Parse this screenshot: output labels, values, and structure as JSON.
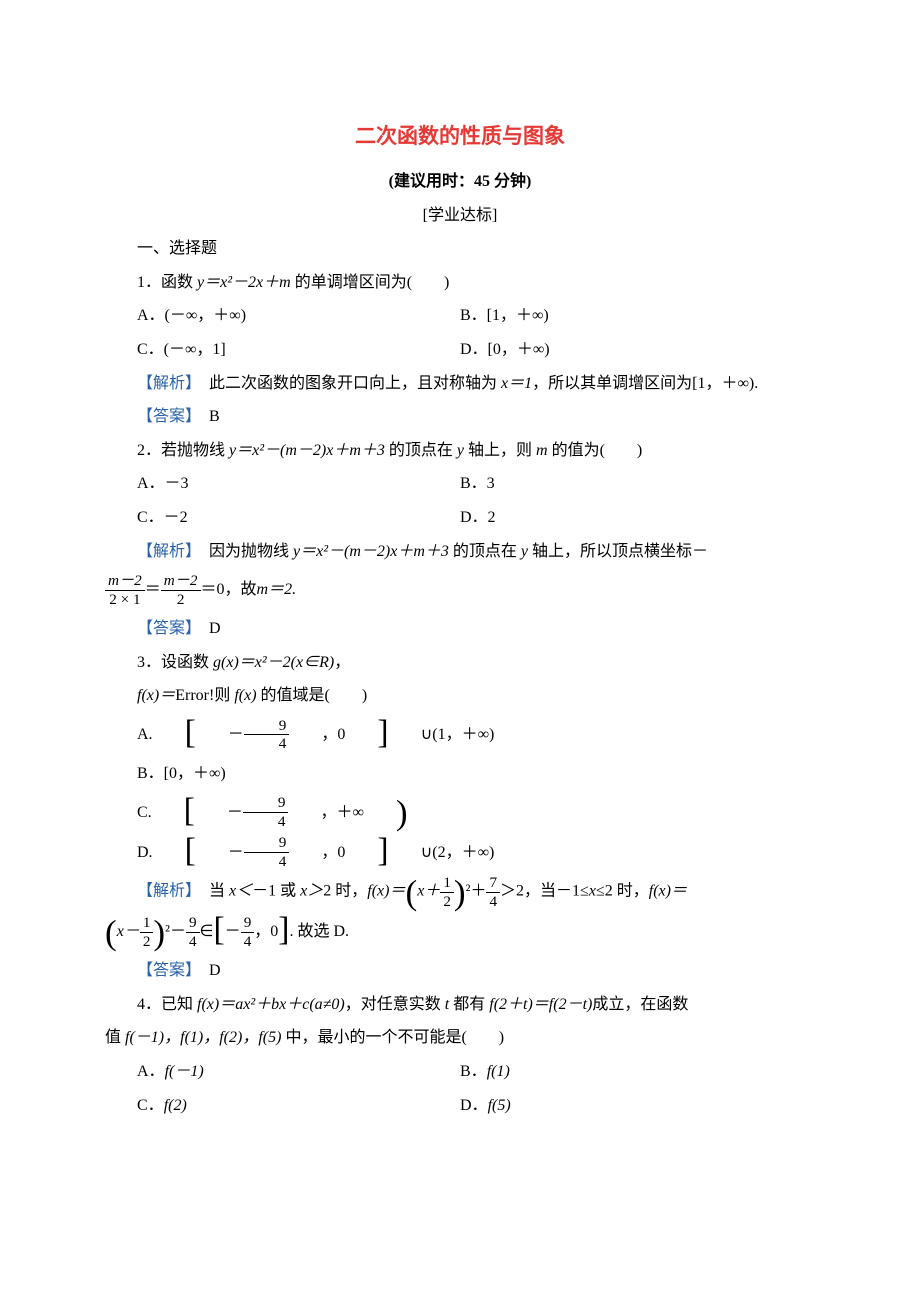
{
  "title": "二次函数的性质与图象",
  "recommended_time": "(建议用时：45 分钟)",
  "section_marker": "[学业达标]",
  "section1_heading": "一、选择题",
  "q1": {
    "stem_pref": "1．函数 ",
    "stem_math": "y＝x²－2x＋m",
    "stem_suf": " 的单调增区间为(　　)",
    "optA": "A．(－∞，＋∞)",
    "optB": "B．[1，＋∞)",
    "optC": "C．(－∞，1]",
    "optD": "D．[0，＋∞)",
    "exp_label": "【解析】",
    "exp_pref": "　此二次函数的图象开口向上，且对称轴为 ",
    "exp_math": "x＝1",
    "exp_suf": "，所以其单调增区间为[1，＋∞).",
    "ans_label": "【答案】",
    "ans": "　B"
  },
  "q2": {
    "stem_pref": "2．若抛物线 ",
    "stem_math": "y＝x²－(m－2)x＋m＋3",
    "stem_suf1": " 的顶点在 ",
    "stem_math2": "y",
    "stem_suf2": " 轴上，则 ",
    "stem_math3": "m",
    "stem_suf3": " 的值为(　　)",
    "optA": "A．－3",
    "optB": "B．3",
    "optC": "C．－2",
    "optD": "D．2",
    "exp_label": "【解析】",
    "exp_pref": "　因为抛物线 ",
    "exp_math1": "y＝x²－(m－2)x＋m＋3",
    "exp_mid1": " 的顶点在 ",
    "exp_math2": "y",
    "exp_mid2": " 轴上，所以顶点横坐标－",
    "frac1_num": "m－2",
    "frac1_den": "2 × 1",
    "eq1": "＝",
    "frac2_num": "m－2",
    "frac2_den": "2",
    "eq2": "＝0，故 ",
    "exp_math3": "m＝2.",
    "ans_label": "【答案】",
    "ans": "　D"
  },
  "q3": {
    "line1_pref": "3．设函数 ",
    "line1_math": "g(x)＝x²－2(x∈R)",
    "line1_suf": "，",
    "line2_pref": "f(x)＝",
    "line2_err": "Error!",
    "line2_mid": "则 ",
    "line2_math": "f(x)",
    "line2_suf": " 的值域是(　　)",
    "optA_pref": "A.",
    "optA_frac_num": "9",
    "optA_frac_den": "4",
    "optA_mid": "，0",
    "optA_suf": "∪(1，＋∞)",
    "optB": "B．[0，＋∞)",
    "optC_pref": "C.",
    "optC_frac_num": "9",
    "optC_frac_den": "4",
    "optC_suf": "，＋∞",
    "optD_pref": "D.",
    "optD_frac_num": "9",
    "optD_frac_den": "4",
    "optD_mid": "，0",
    "optD_suf": "∪(2，＋∞)",
    "exp_label": "【解析】",
    "exp_pref": "　当 ",
    "exp_m1": "x＜",
    "exp_m2": "－1 或 ",
    "exp_m3": "x＞",
    "exp_m4": "2 时，",
    "exp_m5": "f(x)＝",
    "exp_frac1_num": "1",
    "exp_frac1_den": "2",
    "exp_m6": "²＋",
    "exp_frac2_num": "7",
    "exp_frac2_den": "4",
    "exp_m7": "＞2，当－1≤",
    "exp_m7b": "x",
    "exp_m7c": "≤2 时，",
    "exp_m8": "f(x)＝",
    "exp_frac3_num": "1",
    "exp_frac3_den": "2",
    "exp_m9": "²－",
    "exp_frac4_num": "9",
    "exp_frac4_den": "4",
    "exp_m10": "∈",
    "exp_frac5_num": "9",
    "exp_frac5_den": "4",
    "exp_m11": "，0",
    "exp_end": ". 故选 D.",
    "ans_label": "【答案】",
    "ans": "　D"
  },
  "q4": {
    "line1_pref": "4．已知 ",
    "line1_math1": "f(x)＝ax²＋bx＋c(a≠0)",
    "line1_mid1": "，对任意实数 ",
    "line1_math2": "t",
    "line1_mid2": " 都有 ",
    "line1_math3": "f(2＋t)＝f(2－t)",
    "line1_suf": "成立，在函数",
    "line2_pref": "值 ",
    "line2_math": "f(－1)，f(1)，f(2)，f(5)",
    "line2_suf": " 中，最小的一个不可能是(　　)",
    "optA_pref": "A．",
    "optA_math": "f(－1)",
    "optB_pref": "B．",
    "optB_math": "f(1)",
    "optC_pref": "C．",
    "optC_math": "f(2)",
    "optD_pref": "D．",
    "optD_math": "f(5)"
  }
}
